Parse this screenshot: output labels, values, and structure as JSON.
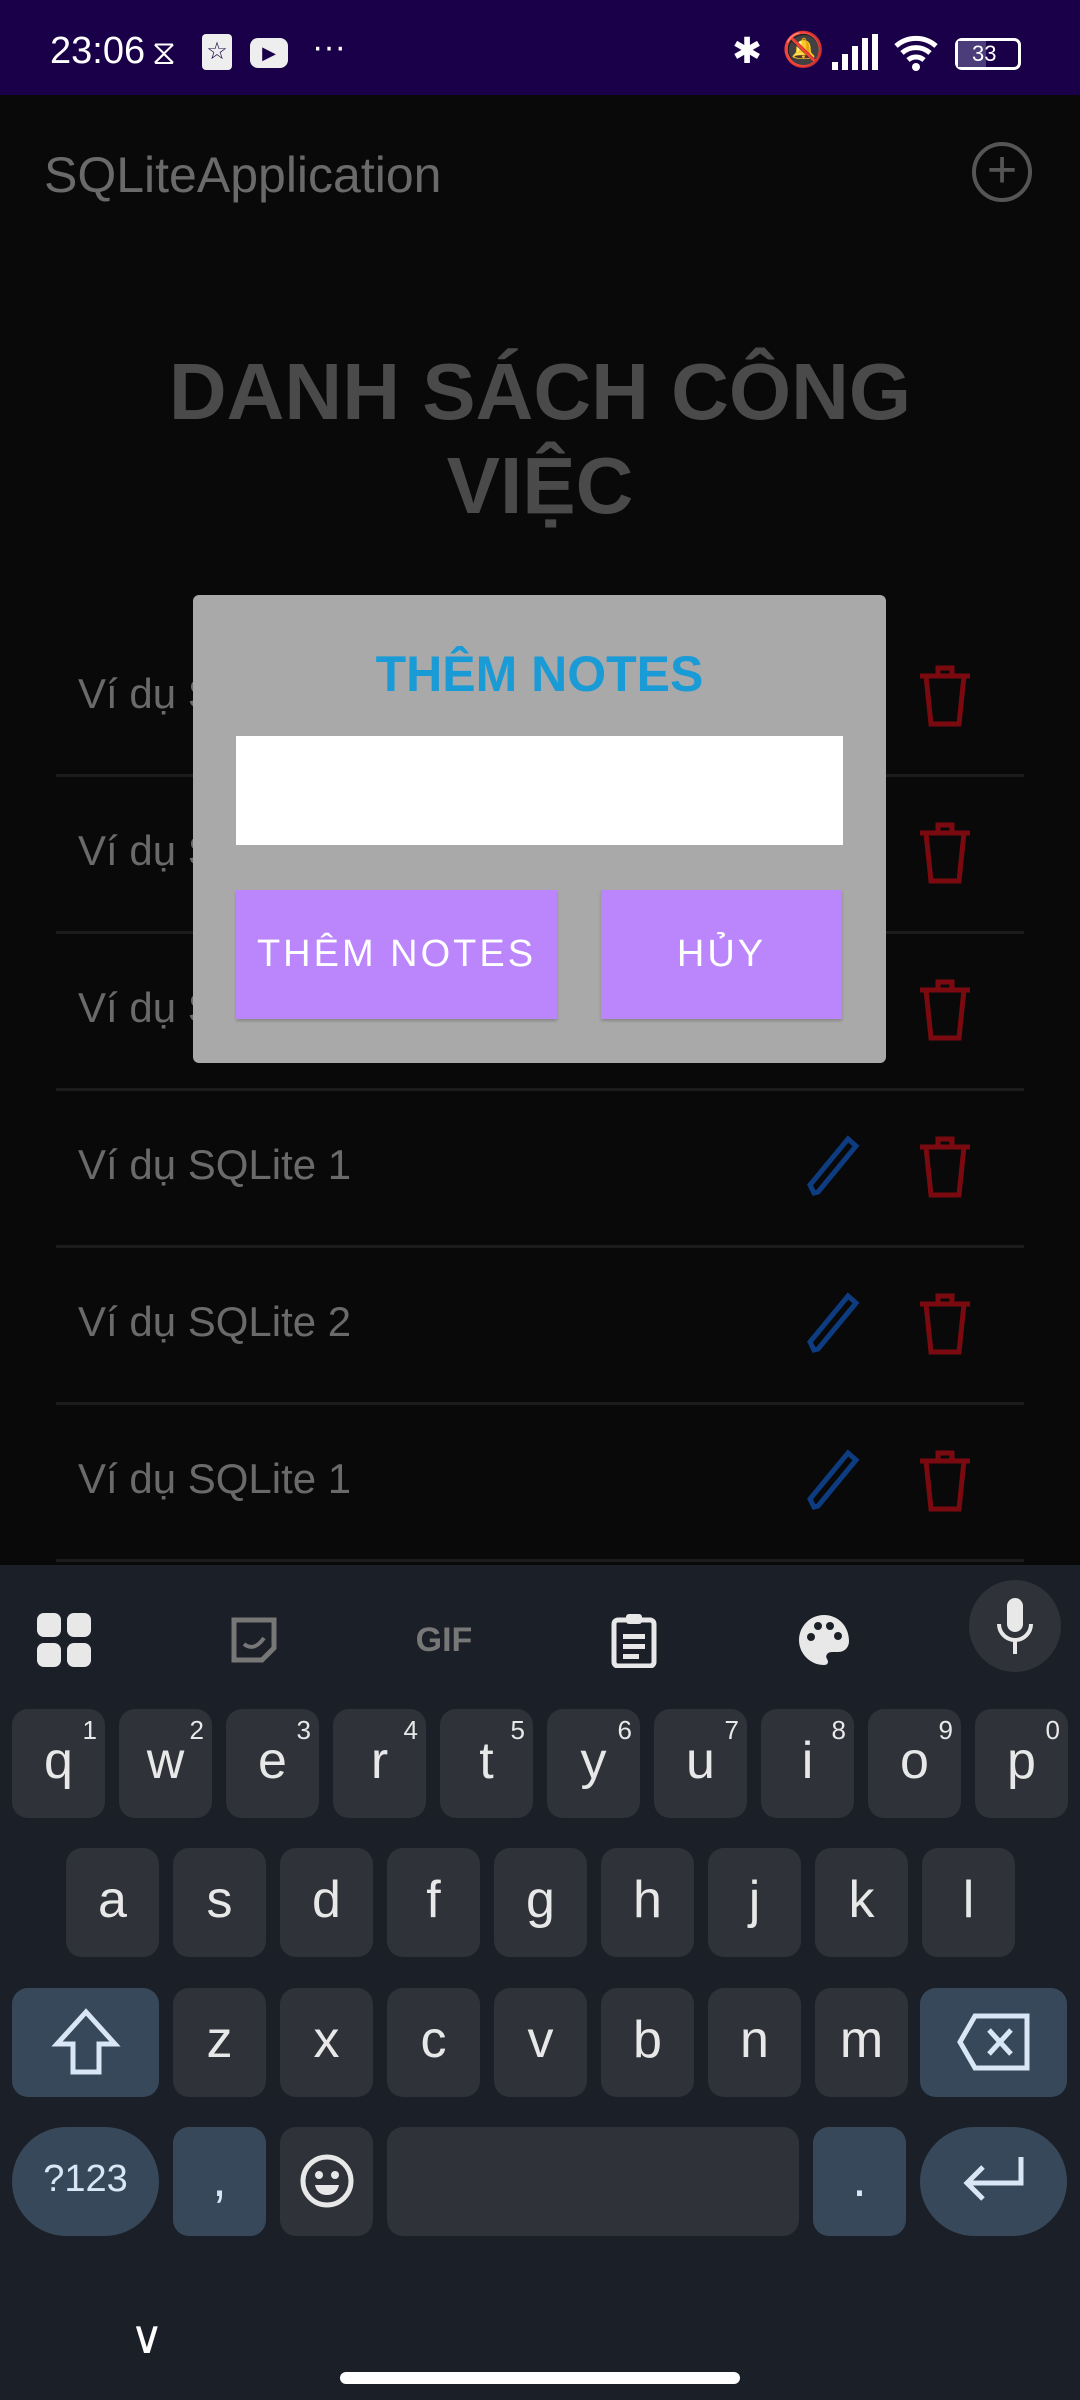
{
  "status_bar": {
    "time": "23:06",
    "battery": "33",
    "icons": [
      "capcut-icon",
      "star-app-icon",
      "youtube-icon",
      "more-dots-icon",
      "bluetooth-icon",
      "bell-muted-icon",
      "signal-icon",
      "wifi-icon",
      "battery-icon"
    ]
  },
  "app_bar": {
    "title": "SQLiteApplication",
    "add_icon": "plus-circle-icon"
  },
  "heading": {
    "line1": "DANH SÁCH CÔNG",
    "line2": "VIỆC"
  },
  "list": [
    {
      "text": "Ví dụ S"
    },
    {
      "text": "Ví dụ S"
    },
    {
      "text": "Ví dụ S"
    },
    {
      "text": "Ví dụ SQLite 1"
    },
    {
      "text": "Ví dụ SQLite 2"
    },
    {
      "text": "Ví dụ SQLite 1"
    }
  ],
  "colors": {
    "edit": "#0d3c80",
    "delete": "#7a0a0f",
    "dialog_title": "#1a9bd6",
    "button": "#bb86fc",
    "status_bar": "#1a0048"
  },
  "dialog": {
    "title": "THÊM NOTES",
    "input_value": "",
    "confirm_label": "THÊM NOTES",
    "cancel_label": "HỦY"
  },
  "keyboard": {
    "toolbar": [
      "apps-grid-icon",
      "sticker-icon",
      "gif-icon",
      "clipboard-icon",
      "palette-icon",
      "microphone-icon"
    ],
    "gif_label": "GIF",
    "row1": [
      {
        "k": "q",
        "n": "1"
      },
      {
        "k": "w",
        "n": "2"
      },
      {
        "k": "e",
        "n": "3"
      },
      {
        "k": "r",
        "n": "4"
      },
      {
        "k": "t",
        "n": "5"
      },
      {
        "k": "y",
        "n": "6"
      },
      {
        "k": "u",
        "n": "7"
      },
      {
        "k": "i",
        "n": "8"
      },
      {
        "k": "o",
        "n": "9"
      },
      {
        "k": "p",
        "n": "0"
      }
    ],
    "row2": [
      "a",
      "s",
      "d",
      "f",
      "g",
      "h",
      "j",
      "k",
      "l"
    ],
    "row3": [
      "z",
      "x",
      "c",
      "v",
      "b",
      "n",
      "m"
    ],
    "symbols_label": "?123",
    "comma": ",",
    "period": "."
  }
}
